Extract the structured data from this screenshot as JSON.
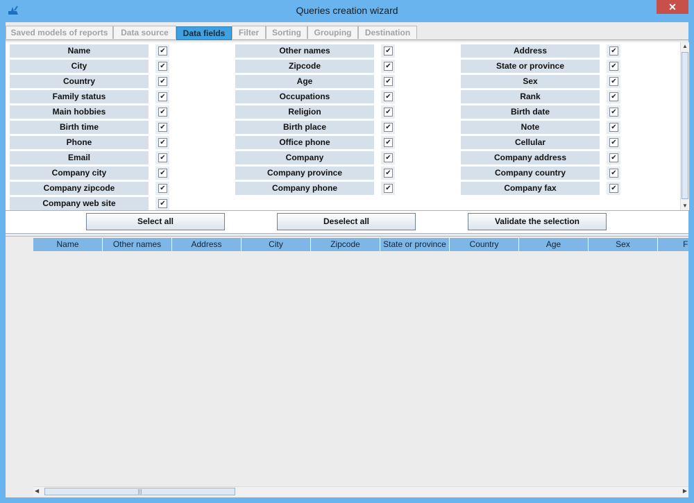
{
  "window": {
    "title": "Queries creation wizard",
    "close_glyph": "✕"
  },
  "tabs": [
    {
      "label": "Saved models of reports"
    },
    {
      "label": "Data source"
    },
    {
      "label": "Data fields"
    },
    {
      "label": "Filter"
    },
    {
      "label": "Sorting"
    },
    {
      "label": "Grouping"
    },
    {
      "label": "Destination"
    }
  ],
  "active_tab": "Data fields",
  "fields": {
    "column1": [
      {
        "label": "Name",
        "checked": true
      },
      {
        "label": "City",
        "checked": true
      },
      {
        "label": "Country",
        "checked": true
      },
      {
        "label": "Family status",
        "checked": true
      },
      {
        "label": "Main hobbies",
        "checked": true
      },
      {
        "label": "Birth time",
        "checked": true
      },
      {
        "label": "Phone",
        "checked": true
      },
      {
        "label": "Email",
        "checked": true
      },
      {
        "label": "Company city",
        "checked": true
      },
      {
        "label": "Company zipcode",
        "checked": true
      },
      {
        "label": "Company web site",
        "checked": true
      }
    ],
    "column2": [
      {
        "label": "Other names",
        "checked": true
      },
      {
        "label": "Zipcode",
        "checked": true
      },
      {
        "label": "Age",
        "checked": true
      },
      {
        "label": "Occupations",
        "checked": true
      },
      {
        "label": "Religion",
        "checked": true
      },
      {
        "label": "Birth place",
        "checked": true
      },
      {
        "label": "Office phone",
        "checked": true
      },
      {
        "label": "Company",
        "checked": true
      },
      {
        "label": "Company province",
        "checked": true
      },
      {
        "label": "Company phone",
        "checked": true
      }
    ],
    "column3": [
      {
        "label": "Address",
        "checked": true
      },
      {
        "label": "State or province",
        "checked": true
      },
      {
        "label": "Sex",
        "checked": true
      },
      {
        "label": "Rank",
        "checked": true
      },
      {
        "label": "Birth date",
        "checked": true
      },
      {
        "label": "Note",
        "checked": true
      },
      {
        "label": "Cellular",
        "checked": true
      },
      {
        "label": "Company address",
        "checked": true
      },
      {
        "label": "Company country",
        "checked": true
      },
      {
        "label": "Company fax",
        "checked": true
      }
    ],
    "check_glyph": "✔"
  },
  "buttons": {
    "select_all": "Select all",
    "deselect_all": "Deselect all",
    "validate": "Validate the selection"
  },
  "grid": {
    "columns": [
      "Name",
      "Other names",
      "Address",
      "City",
      "Zipcode",
      "State or province",
      "Country",
      "Age",
      "Sex",
      "Fami"
    ]
  },
  "scroll": {
    "up": "▲",
    "down": "▼",
    "left": "◀",
    "right": "▶",
    "grip": "|||"
  }
}
